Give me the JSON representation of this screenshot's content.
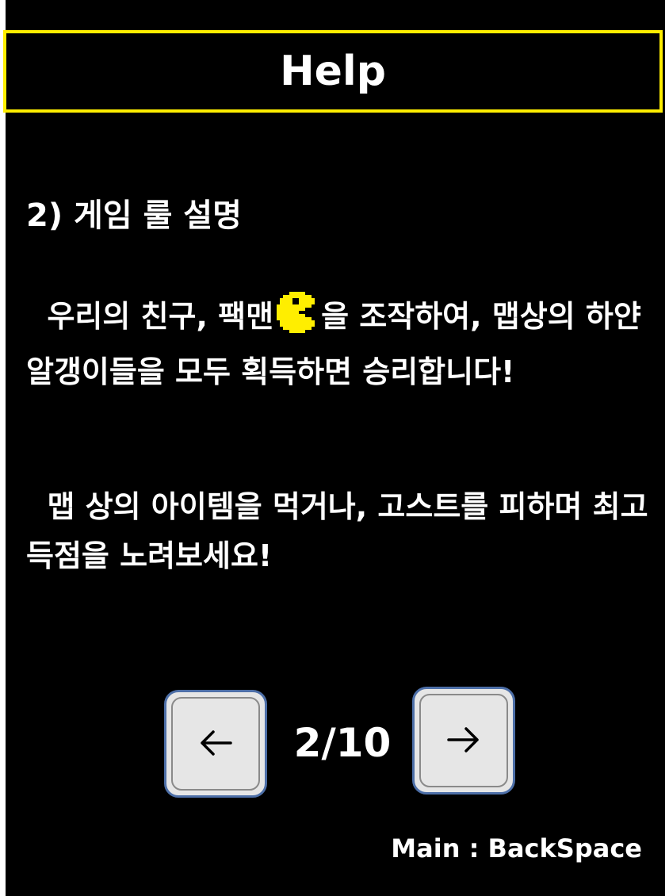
{
  "header": {
    "title": "Help"
  },
  "content": {
    "heading": "2) 게임 룰 설명",
    "paragraph1_before_icon": "우리의 친구, 팩맨",
    "paragraph1_after_icon": "을 조작하여, 맵상의 하얀 알갱이들을 모두 획득하면 승리합니다!",
    "paragraph2": "맵 상의 아이템을 먹거나, 고스트를 피하며 최고 득점을 노려보세요!",
    "icon": "pacman-icon",
    "icon_color": "#ffee00"
  },
  "pagination": {
    "current": 2,
    "total": 10,
    "label": "2/10",
    "prev_icon": "arrow-left-icon",
    "next_icon": "arrow-right-icon"
  },
  "footer": {
    "hint": "Main : BackSpace"
  },
  "colors": {
    "background": "#000000",
    "title_border": "#ffee00",
    "text": "#ffffff",
    "button_face": "#e6e6e6",
    "button_border": "#4d6fa8"
  }
}
